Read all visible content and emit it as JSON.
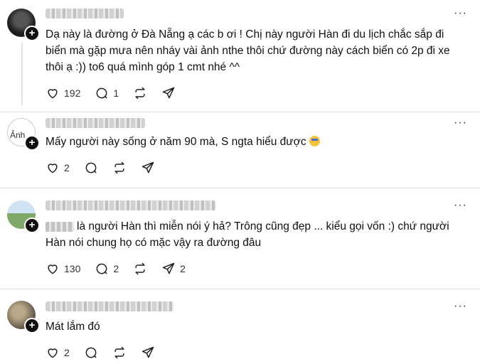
{
  "posts": [
    {
      "avatar_icon": "user-avatar",
      "text": "Dạ này là đường ở Đà Nẵng ạ các b ơi ! Chị này người Hàn đi du lịch chắc sắp đi biển mà gặp mưa nên nháy vài ảnh nthe thôi chứ đường này cách biển có 2p đi xe thôi ạ :)) to6 quá mình góp 1 cmt nhé ^^",
      "likes": "192",
      "replies": "1",
      "reposts": "",
      "shares": ""
    },
    {
      "avatar_icon": "broken-image-avatar",
      "avatar_alt": "Ảnh",
      "text": "Mấy người này sống ở năm 90 mà, S ngta hiểu được",
      "likes": "2",
      "replies": "",
      "reposts": "",
      "shares": ""
    },
    {
      "avatar_icon": "landscape-avatar",
      "text": "là người Hàn thì miễn nói ý hả? Trông cũng đẹp ... kiểu gọi vốn :) chứ người Hàn nói chung họ có mặc vậy ra đường đâu",
      "likes": "130",
      "replies": "2",
      "reposts": "",
      "shares": "2"
    },
    {
      "avatar_icon": "user-avatar",
      "text": "Mát lắm đó",
      "likes": "2",
      "replies": "",
      "reposts": "",
      "shares": ""
    }
  ],
  "more_label": "···",
  "follow_label": "+"
}
